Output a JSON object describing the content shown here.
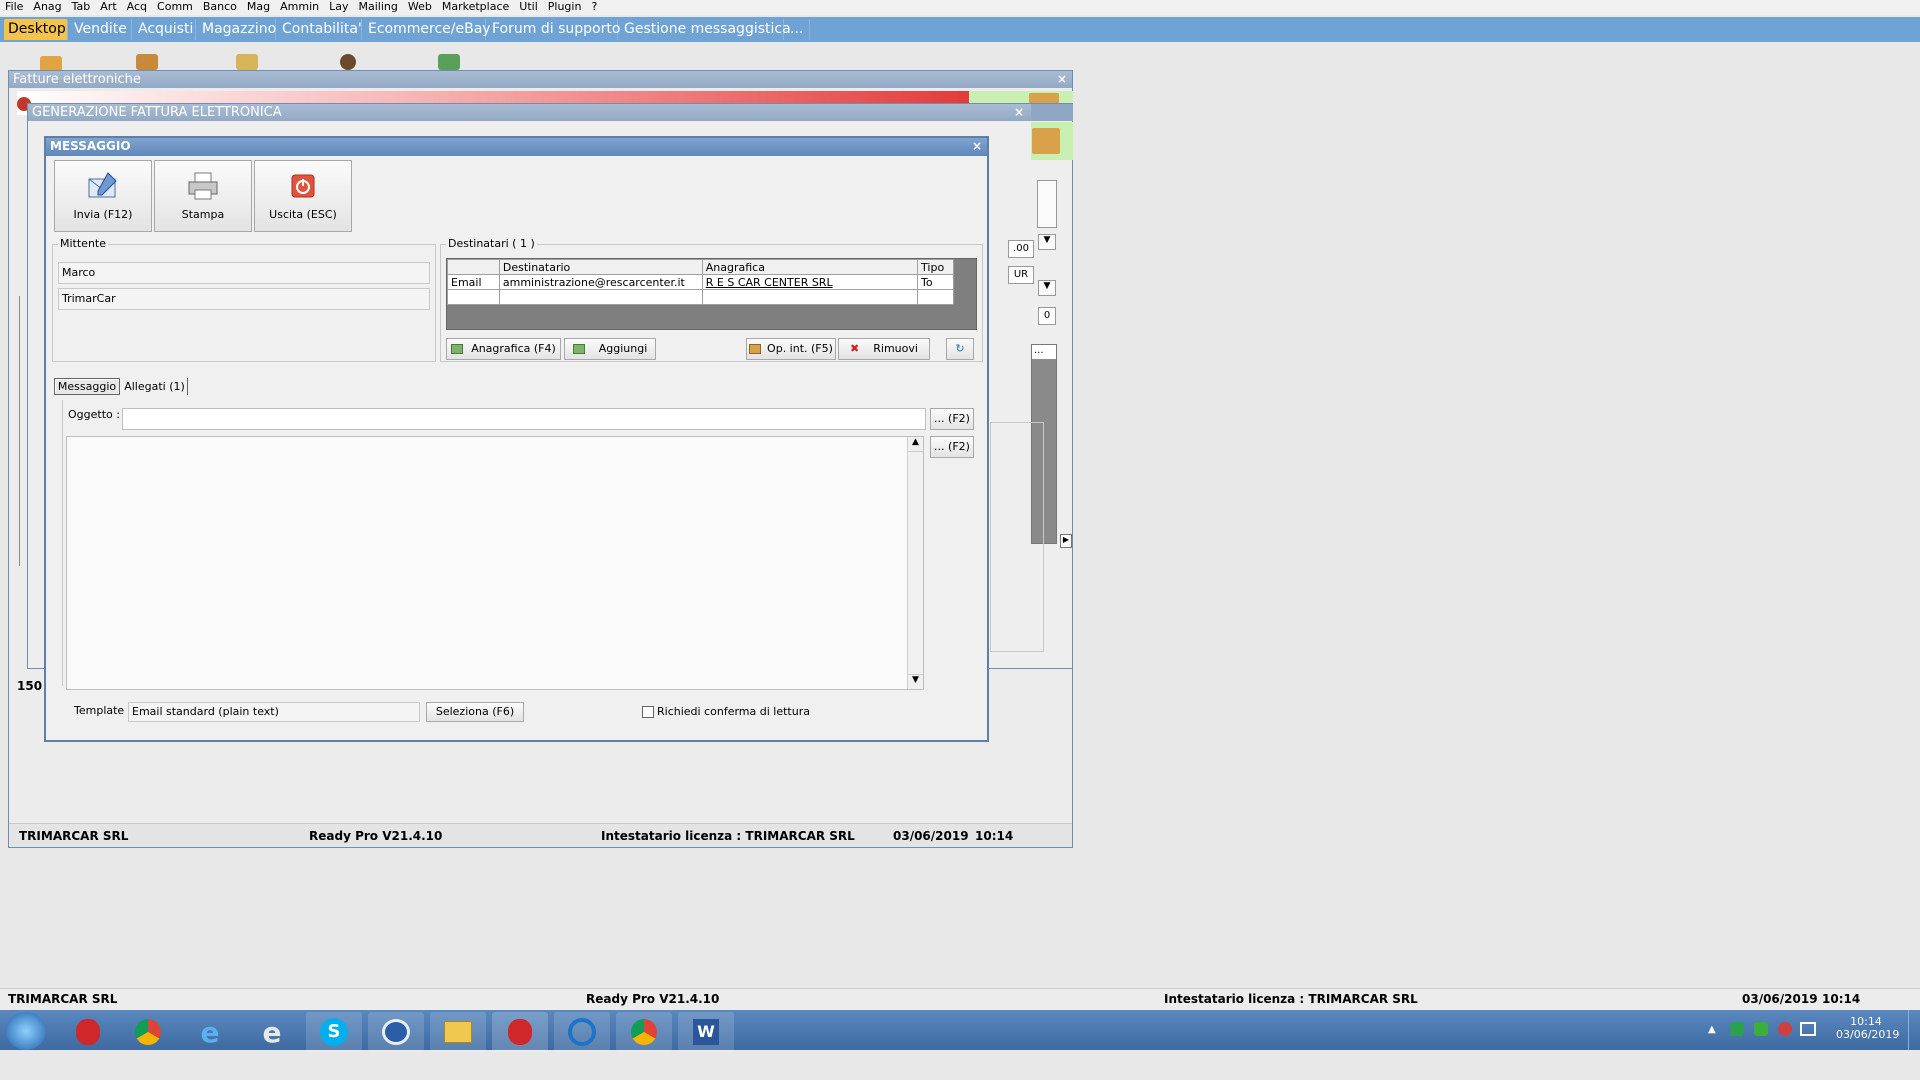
{
  "menubar": [
    "File",
    "Anag",
    "Tab",
    "Art",
    "Acq",
    "Comm",
    "Banco",
    "Mag",
    "Ammin",
    "Lay",
    "Mailing",
    "Web",
    "Marketplace",
    "Util",
    "Plugin",
    "?"
  ],
  "module_tabs": [
    "Desktop",
    "Vendite",
    "Acquisti",
    "Magazzino",
    "Contabilita'",
    "Ecommerce/eBay",
    "Forum di supporto",
    "Gestione messaggistica",
    "..."
  ],
  "win_fatture": {
    "title": "Fatture elettroniche",
    "close": "×",
    "left_count": "150"
  },
  "win_generazione": {
    "title": "GENERAZIONE FATTURA ELETTRONICA",
    "close": "×",
    "right_fragments": [
      ".00",
      "UR",
      "0",
      "..."
    ]
  },
  "win_messaggio": {
    "title": "MESSAGGIO",
    "close": "×",
    "toolbar": {
      "send": "Invia (F12)",
      "print": "Stampa",
      "exit": "Uscita (ESC)"
    },
    "mittente": {
      "label": "Mittente",
      "name": "Marco",
      "company": "TrimarCar"
    },
    "destinatari": {
      "label": "Destinatari ( 1 )",
      "columns": [
        "",
        "Destinatario",
        "Anagrafica",
        "Tipo"
      ],
      "rows": [
        [
          "Email",
          "amministrazione@rescarcenter.it",
          "R E S CAR CENTER SRL",
          "To"
        ]
      ],
      "buttons": {
        "anagrafica": "Anagrafica (F4)",
        "aggiungi": "Aggiungi",
        "opint": "Op. int. (F5)",
        "rimuovi": "Rimuovi"
      }
    },
    "tabs": {
      "messaggio": "Messaggio",
      "allegati": "Allegati (1)"
    },
    "oggetto": {
      "label": "Oggetto :",
      "value": "",
      "button": "... (F2)"
    },
    "body": {
      "value": "",
      "button": "... (F2)"
    },
    "template": {
      "label": "Template :",
      "value": "Email standard (plain text)",
      "button": "Seleziona (F6)"
    },
    "read_receipt": "Richiedi conferma di lettura"
  },
  "inner_status": {
    "company": "TRIMARCAR SRL",
    "version": "Ready Pro V21.4.10",
    "license": "Intestatario licenza : TRIMARCAR SRL",
    "date": "03/06/2019",
    "time": "10:14"
  },
  "outer_status": {
    "company": "TRIMARCAR SRL",
    "version": "Ready Pro V21.4.10",
    "license": "Intestatario licenza : TRIMARCAR SRL",
    "date": "03/06/2019",
    "time": "10:14"
  },
  "taskbar": {
    "clock_time": "10:14",
    "clock_date": "03/06/2019"
  },
  "colors": {
    "tab_bar": "#6fa3d6",
    "active_tab": "#f4c44a",
    "title_blue": "#5f87ba",
    "taskbar": "#3e6aa0"
  }
}
